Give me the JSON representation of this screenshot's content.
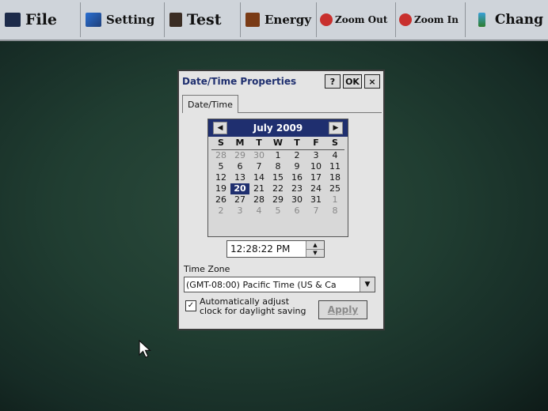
{
  "menubar": {
    "items": [
      {
        "label": "File",
        "icon": "monitor-icon"
      },
      {
        "label": "Setting",
        "icon": "settings-icon"
      },
      {
        "label": "Test",
        "icon": "test-icon"
      },
      {
        "label": "Energy",
        "icon": "book-icon"
      },
      {
        "label": "Zoom Out",
        "icon": "zoom-out-icon"
      },
      {
        "label": "Zoom In",
        "icon": "zoom-in-icon"
      },
      {
        "label": "Chang",
        "icon": "change-icon"
      }
    ]
  },
  "dialog": {
    "title": "Date/Time Properties",
    "help_label": "?",
    "ok_label": "OK",
    "close_label": "×",
    "tab_label": "Date/Time",
    "calendar": {
      "month_label": "July 2009",
      "prev_glyph": "◀",
      "next_glyph": "▶",
      "weekdays": [
        "S",
        "M",
        "T",
        "W",
        "T",
        "F",
        "S"
      ],
      "weeks": [
        [
          "28",
          "29",
          "30",
          "1",
          "2",
          "3",
          "4"
        ],
        [
          "5",
          "6",
          "7",
          "8",
          "9",
          "10",
          "11"
        ],
        [
          "12",
          "13",
          "14",
          "15",
          "16",
          "17",
          "18"
        ],
        [
          "19",
          "20",
          "21",
          "22",
          "23",
          "24",
          "25"
        ],
        [
          "26",
          "27",
          "28",
          "29",
          "30",
          "31",
          "1"
        ],
        [
          "2",
          "3",
          "4",
          "5",
          "6",
          "7",
          "8"
        ]
      ],
      "selected_day": "20"
    },
    "time_value": "12:28:22 PM",
    "timezone_label": "Time Zone",
    "timezone_value": "(GMT-08:00) Pacific Time (US & Ca",
    "auto_adjust_label": "Automatically adjust\nclock for daylight saving",
    "auto_adjust_checked": true,
    "apply_label": "Apply"
  },
  "colors": {
    "title_blue": "#1f2f6f",
    "desktop_green": "#203d31"
  }
}
